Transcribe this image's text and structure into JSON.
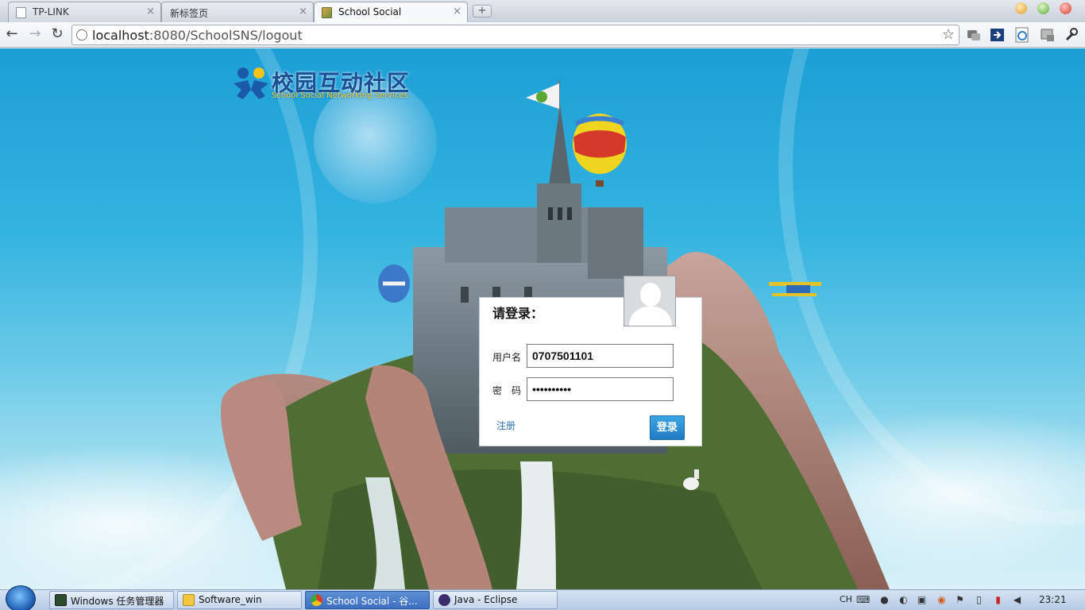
{
  "browser": {
    "tabs": [
      {
        "label": "TP-LINK",
        "active": false,
        "close": "×"
      },
      {
        "label": "新标签页",
        "active": false,
        "close": "×"
      },
      {
        "label": "School Social",
        "active": true,
        "close": "×"
      }
    ],
    "new_tab": "+",
    "url": {
      "host": "localhost",
      "rest": ":8080/SchoolSNS/logout"
    },
    "icons": {
      "back": "←",
      "forward": "→",
      "reload": "↻",
      "star": "☆",
      "extensions": [
        "translate-icon",
        "forward-arrow-icon",
        "ie-tab-icon",
        "tools-icon",
        "wrench-icon"
      ]
    }
  },
  "page": {
    "logo": {
      "title": "校园互动社区",
      "subtitle": "School Social Networking Services"
    },
    "login": {
      "title": "请登录：",
      "username_label": "用户名",
      "username_value": "0707501101",
      "password_label": "密　码",
      "password_value": "••••••••••",
      "register_label": "注册",
      "submit_label": "登录"
    }
  },
  "taskbar": {
    "items": [
      {
        "label": "Windows 任务管理器",
        "icon": "task-manager-icon",
        "active": false
      },
      {
        "label": "Software_win",
        "icon": "folder-icon",
        "active": false
      },
      {
        "label": "School Social - 谷...",
        "icon": "chrome-icon",
        "active": true
      },
      {
        "label": "Java  -  Eclipse",
        "icon": "eclipse-icon",
        "active": false
      }
    ],
    "ime": "CH",
    "clock": "23:21"
  },
  "colors": {
    "accent": "#1f7cc4",
    "logo_blue": "#1a4f96",
    "logo_yellow": "#ffd22a"
  }
}
